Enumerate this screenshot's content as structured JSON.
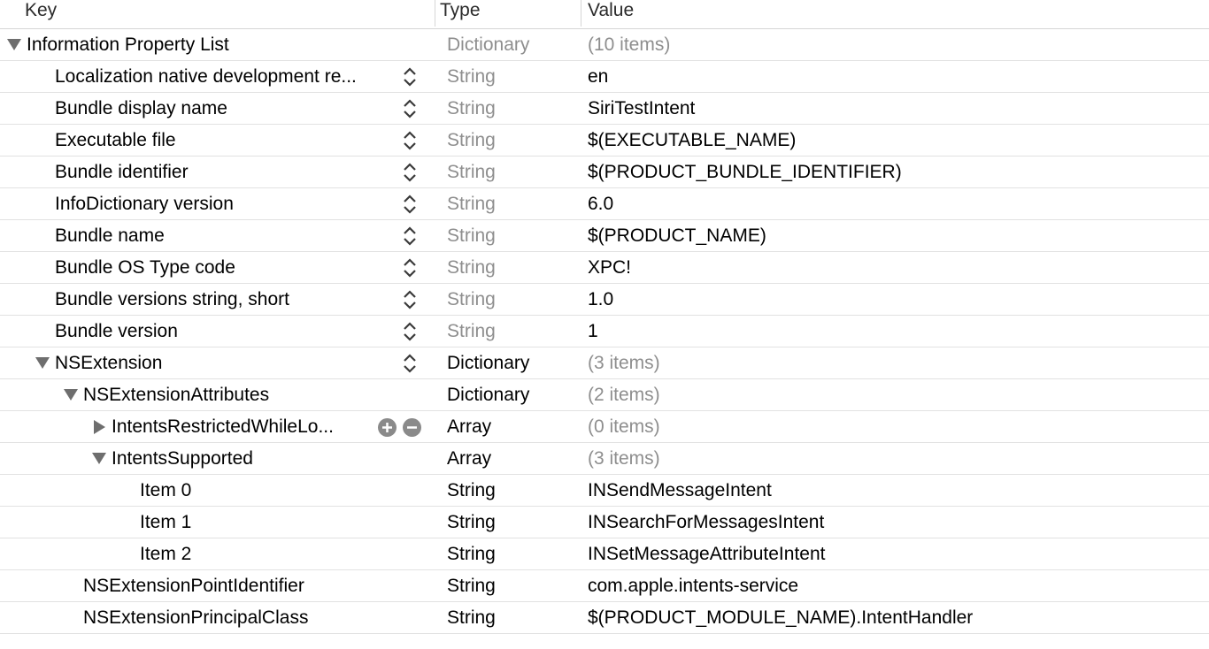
{
  "header": {
    "key_label": "Key",
    "type_label": "Type",
    "value_label": "Value"
  },
  "rows": [
    {
      "key": "Information Property List",
      "type": "Dictionary",
      "value": "(10 items)"
    },
    {
      "key": "Localization native development re...",
      "type": "String",
      "value": "en"
    },
    {
      "key": "Bundle display name",
      "type": "String",
      "value": "SiriTestIntent"
    },
    {
      "key": "Executable file",
      "type": "String",
      "value": "$(EXECUTABLE_NAME)"
    },
    {
      "key": "Bundle identifier",
      "type": "String",
      "value": "$(PRODUCT_BUNDLE_IDENTIFIER)"
    },
    {
      "key": "InfoDictionary version",
      "type": "String",
      "value": "6.0"
    },
    {
      "key": "Bundle name",
      "type": "String",
      "value": "$(PRODUCT_NAME)"
    },
    {
      "key": "Bundle OS Type code",
      "type": "String",
      "value": "XPC!"
    },
    {
      "key": "Bundle versions string, short",
      "type": "String",
      "value": "1.0"
    },
    {
      "key": "Bundle version",
      "type": "String",
      "value": "1"
    },
    {
      "key": "NSExtension",
      "type": "Dictionary",
      "value": "(3 items)"
    },
    {
      "key": "NSExtensionAttributes",
      "type": "Dictionary",
      "value": "(2 items)"
    },
    {
      "key": "IntentsRestrictedWhileLo...",
      "type": "Array",
      "value": "(0 items)"
    },
    {
      "key": "IntentsSupported",
      "type": "Array",
      "value": "(3 items)"
    },
    {
      "key": "Item 0",
      "type": "String",
      "value": "INSendMessageIntent"
    },
    {
      "key": "Item 1",
      "type": "String",
      "value": "INSearchForMessagesIntent"
    },
    {
      "key": "Item 2",
      "type": "String",
      "value": "INSetMessageAttributeIntent"
    },
    {
      "key": "NSExtensionPointIdentifier",
      "type": "String",
      "value": "com.apple.intents-service"
    },
    {
      "key": "NSExtensionPrincipalClass",
      "type": "String",
      "value": "$(PRODUCT_MODULE_NAME).IntentHandler"
    }
  ],
  "icons": {
    "expand_down": "disclosure-triangle-down-icon",
    "expand_right": "disclosure-triangle-right-icon",
    "stepper": "up-down-stepper-icon",
    "add": "plus-circle-icon",
    "remove": "minus-circle-icon"
  },
  "colors": {
    "muted_text": "#8e8e8e",
    "row_border": "#e2e2e2",
    "triangle": "#6e6e6e"
  }
}
